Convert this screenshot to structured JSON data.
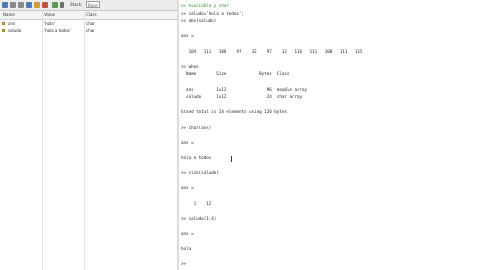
{
  "workspace": {
    "toolbar": {
      "stack_label": "Stack:",
      "stack_value": "Base"
    },
    "columns": [
      "Name",
      "Value",
      "Class"
    ],
    "variables": [
      {
        "name": "ans",
        "value": "'hola'",
        "class": "char"
      },
      {
        "name": "saludo",
        "value": "'hola a todos'",
        "class": "char"
      }
    ]
  },
  "command_window": {
    "lines": [
      {
        "text": ">> %variable y char",
        "kind": "green"
      },
      {
        "text": ">> saludo='hola a todos';",
        "kind": "normal"
      },
      {
        "text": ">> abs(saludo)",
        "kind": "normal"
      },
      {
        "text": "",
        "kind": "normal"
      },
      {
        "text": "ans =",
        "kind": "normal"
      },
      {
        "text": "",
        "kind": "normal"
      },
      {
        "text": "   104   111   108    97    32    97    32   116   111   100   111   115",
        "kind": "normal"
      },
      {
        "text": "",
        "kind": "normal"
      },
      {
        "text": ">> whos",
        "kind": "normal"
      },
      {
        "text": "  Name        Size             Bytes  Class",
        "kind": "normal"
      },
      {
        "text": "",
        "kind": "normal"
      },
      {
        "text": "  ans         1x12                96  double array",
        "kind": "normal"
      },
      {
        "text": "  saludo      1x12                24  char array",
        "kind": "normal"
      },
      {
        "text": "",
        "kind": "normal"
      },
      {
        "text": "Grand total is 24 elements using 120 bytes",
        "kind": "normal"
      },
      {
        "text": "",
        "kind": "normal"
      },
      {
        "text": ">> char(ans)",
        "kind": "normal"
      },
      {
        "text": "",
        "kind": "normal"
      },
      {
        "text": "ans =",
        "kind": "normal"
      },
      {
        "text": "",
        "kind": "normal"
      },
      {
        "text": "hola a todos",
        "kind": "normal"
      },
      {
        "text": "",
        "kind": "normal"
      },
      {
        "text": ">> size(saludo)",
        "kind": "normal"
      },
      {
        "text": "",
        "kind": "normal"
      },
      {
        "text": "ans =",
        "kind": "normal"
      },
      {
        "text": "",
        "kind": "normal"
      },
      {
        "text": "     1    12",
        "kind": "normal"
      },
      {
        "text": "",
        "kind": "normal"
      },
      {
        "text": ">> saludo(1:4)",
        "kind": "normal"
      },
      {
        "text": "",
        "kind": "normal"
      },
      {
        "text": "ans =",
        "kind": "normal"
      },
      {
        "text": "",
        "kind": "normal"
      },
      {
        "text": "hola",
        "kind": "normal"
      },
      {
        "text": "",
        "kind": "normal"
      },
      {
        "text": ">>",
        "kind": "normal"
      }
    ]
  }
}
